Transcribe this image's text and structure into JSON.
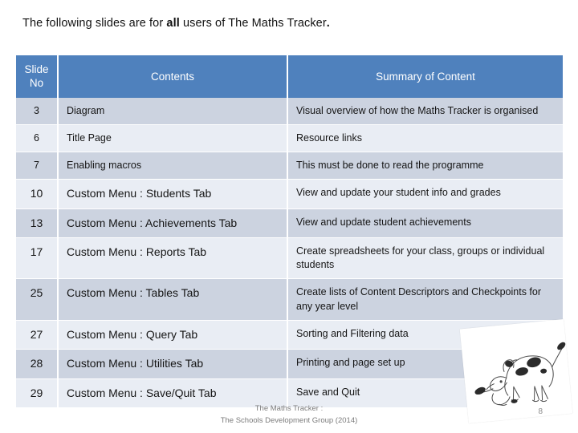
{
  "slide": {
    "title_part1": "The following slides are for ",
    "title_emphasis": "all",
    "title_part2": " users of The Maths Tracker",
    "title_end": "."
  },
  "table": {
    "headers": {
      "slide_no": "Slide\nNo",
      "contents": "Contents",
      "summary": "Summary of Content"
    },
    "rows": [
      {
        "no": "3",
        "contents": "Diagram",
        "summary": "Visual overview of how the Maths Tracker is organised"
      },
      {
        "no": "6",
        "contents": "Title Page",
        "summary": "Resource links"
      },
      {
        "no": "7",
        "contents": "Enabling macros",
        "summary": "This must be done to read the programme"
      },
      {
        "no": "10",
        "contents": "Custom Menu :  Students Tab",
        "summary": "View and update  your student info and grades"
      },
      {
        "no": "13",
        "contents": "Custom Menu :  Achievements Tab",
        "summary": "View and update student achievements"
      },
      {
        "no": "17",
        "contents": "Custom Menu :  Reports Tab",
        "summary": "Create spreadsheets for  your class, groups or individual students"
      },
      {
        "no": "25",
        "contents": "Custom Menu :  Tables Tab",
        "summary": "Create lists of Content Descriptors and Checkpoints for any year level"
      },
      {
        "no": "27",
        "contents": "Custom Menu :  Query Tab",
        "summary": "Sorting and Filtering data"
      },
      {
        "no": "28",
        "contents": "Custom Menu :  Utilities Tab",
        "summary": "Printing and  page set up"
      },
      {
        "no": "29",
        "contents": "Custom Menu :  Save/Quit Tab",
        "summary": "Save and Quit"
      }
    ]
  },
  "footer": {
    "line1": "The Maths Tracker :",
    "line2": "The Schools Development Group (2014)",
    "page_number": "8"
  },
  "colors": {
    "header_blue": "#4F81BD",
    "band_dark": "#CCD3E0",
    "band_light": "#E9EDF4",
    "text": "#151515",
    "footer_text": "#7b7b7b"
  },
  "decorations": {
    "dog_illustration": "dog-line-drawing"
  }
}
